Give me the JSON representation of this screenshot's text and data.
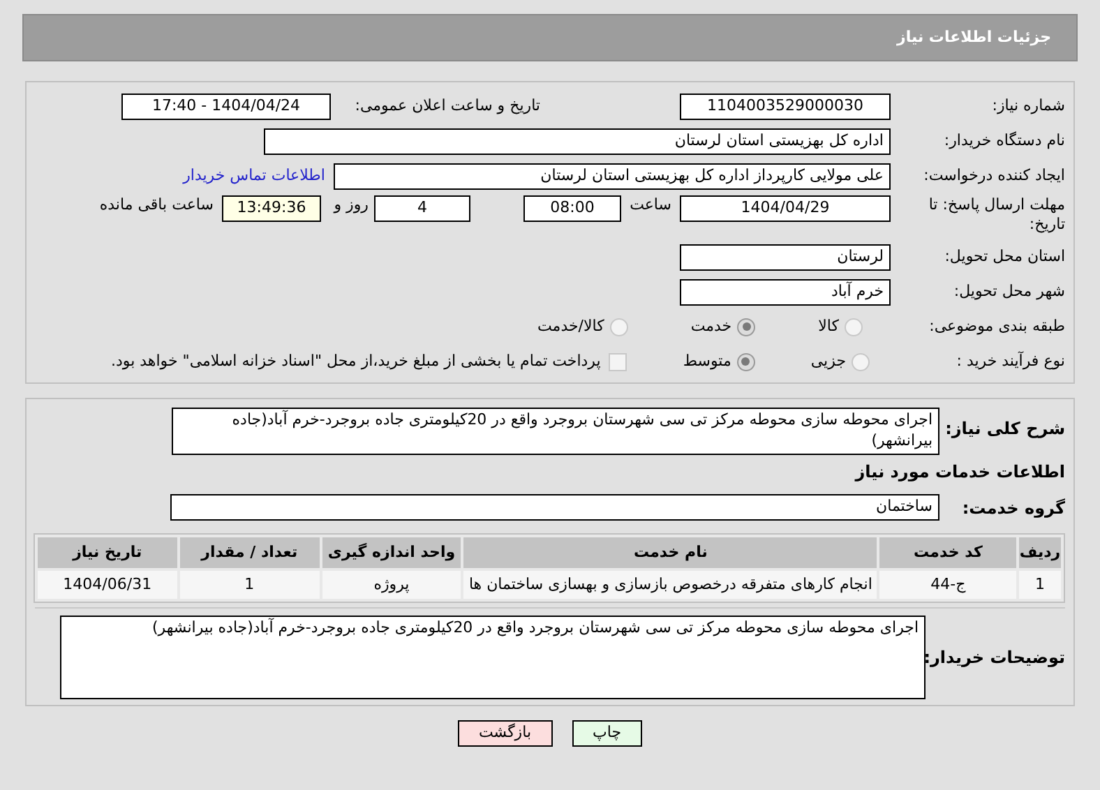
{
  "header": {
    "title": "جزئیات اطلاعات نیاز"
  },
  "need_info": {
    "need_number": {
      "label": "شماره نیاز:",
      "value": "1104003529000030"
    },
    "announcement": {
      "label": "تاریخ و ساعت اعلان عمومی:",
      "value": "1404/04/24 - 17:40"
    },
    "buyer_org": {
      "label": "نام دستگاه خریدار:",
      "value": "اداره کل بهزیستی استان لرستان"
    },
    "creator": {
      "label": "ایجاد کننده درخواست:",
      "value": "علی مولایی کارپرداز اداره کل بهزیستی استان لرستان",
      "link": "اطلاعات تماس خریدار"
    },
    "deadline": {
      "label": "مهلت ارسال پاسخ: تا تاریخ:",
      "date": "1404/04/29",
      "time_label": "ساعت",
      "time": "08:00",
      "days": "4",
      "days_label": "روز و",
      "remaining": "13:49:36",
      "remaining_label": "ساعت باقی مانده"
    },
    "province": {
      "label": "استان محل تحویل:",
      "value": "لرستان"
    },
    "city": {
      "label": "شهر محل تحویل:",
      "value": "خرم آباد"
    },
    "category": {
      "label": "طبقه بندی موضوعی:",
      "options": [
        {
          "label": "کالا",
          "selected": false
        },
        {
          "label": "خدمت",
          "selected": true
        },
        {
          "label": "کالا/خدمت",
          "selected": false
        }
      ]
    },
    "process": {
      "label": "نوع فرآیند خرید :",
      "options": [
        {
          "label": "جزیی",
          "selected": false
        },
        {
          "label": "متوسط",
          "selected": true
        }
      ],
      "payment": {
        "checked": false,
        "label": "پرداخت تمام یا بخشی از مبلغ خرید،از محل \"اسناد خزانه اسلامی\" خواهد بود."
      }
    }
  },
  "details": {
    "description": {
      "label": "شرح کلی نیاز:",
      "value": "اجرای محوطه سازی محوطه مرکز تی سی شهرستان بروجرد واقع در 20کیلومتری جاده بروجرد-خرم آباد(جاده بیرانشهر)"
    },
    "services_heading": "اطلاعات خدمات مورد نیاز",
    "service_group": {
      "label": "گروه خدمت:",
      "value": "ساختمان"
    },
    "table": {
      "columns": [
        "ردیف",
        "کد خدمت",
        "نام خدمت",
        "واحد اندازه گیری",
        "تعداد / مقدار",
        "تاریخ نیاز"
      ],
      "rows": [
        [
          "1",
          "ج-44",
          "انجام کارهای متفرقه درخصوص بازسازی و بهسازی ساختمان ها",
          "پروژه",
          "1",
          "1404/06/31"
        ]
      ]
    },
    "buyer_notes": {
      "label": "توضیحات خریدار:",
      "value": "اجرای محوطه سازی محوطه مرکز تی سی شهرستان بروجرد واقع در 20کیلومتری جاده بروجرد-خرم آباد(جاده بیرانشهر)"
    }
  },
  "buttons": [
    {
      "label": "چاپ",
      "kind": "print"
    },
    {
      "label": "بازگشت",
      "kind": "back"
    }
  ]
}
